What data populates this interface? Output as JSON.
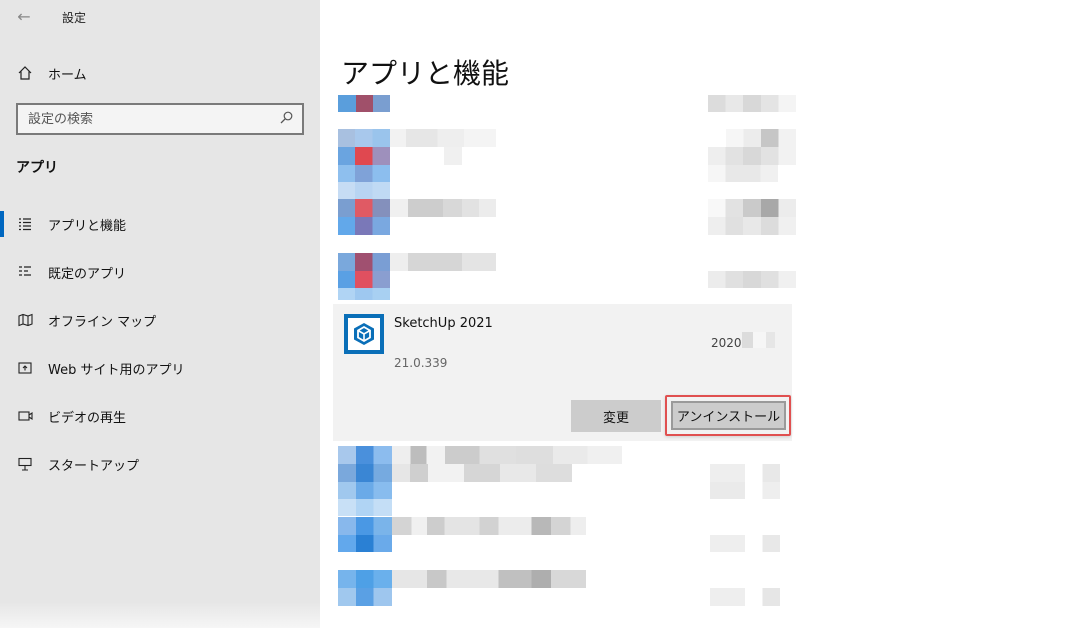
{
  "window": {
    "title": "設定",
    "back_icon": "back-arrow-icon"
  },
  "sidebar": {
    "home_label": "ホーム",
    "search_placeholder": "設定の検索",
    "section_heading": "アプリ",
    "items": [
      {
        "label": "アプリと機能",
        "icon": "list-icon",
        "active": true
      },
      {
        "label": "既定のアプリ",
        "icon": "default-apps-icon",
        "active": false
      },
      {
        "label": "オフライン マップ",
        "icon": "map-icon",
        "active": false
      },
      {
        "label": "Web サイト用のアプリ",
        "icon": "web-apps-icon",
        "active": false
      },
      {
        "label": "ビデオの再生",
        "icon": "video-icon",
        "active": false
      },
      {
        "label": "スタートアップ",
        "icon": "startup-icon",
        "active": false
      }
    ]
  },
  "main": {
    "title": "アプリと機能",
    "selected_app": {
      "name": "SketchUp 2021",
      "version": "21.0.339",
      "date": "2020",
      "modify_label": "変更",
      "uninstall_label": "アンインストール"
    }
  },
  "colors": {
    "accent": "#0067c0",
    "highlight": "#e05050",
    "app_icon": "#0a6fb8"
  }
}
